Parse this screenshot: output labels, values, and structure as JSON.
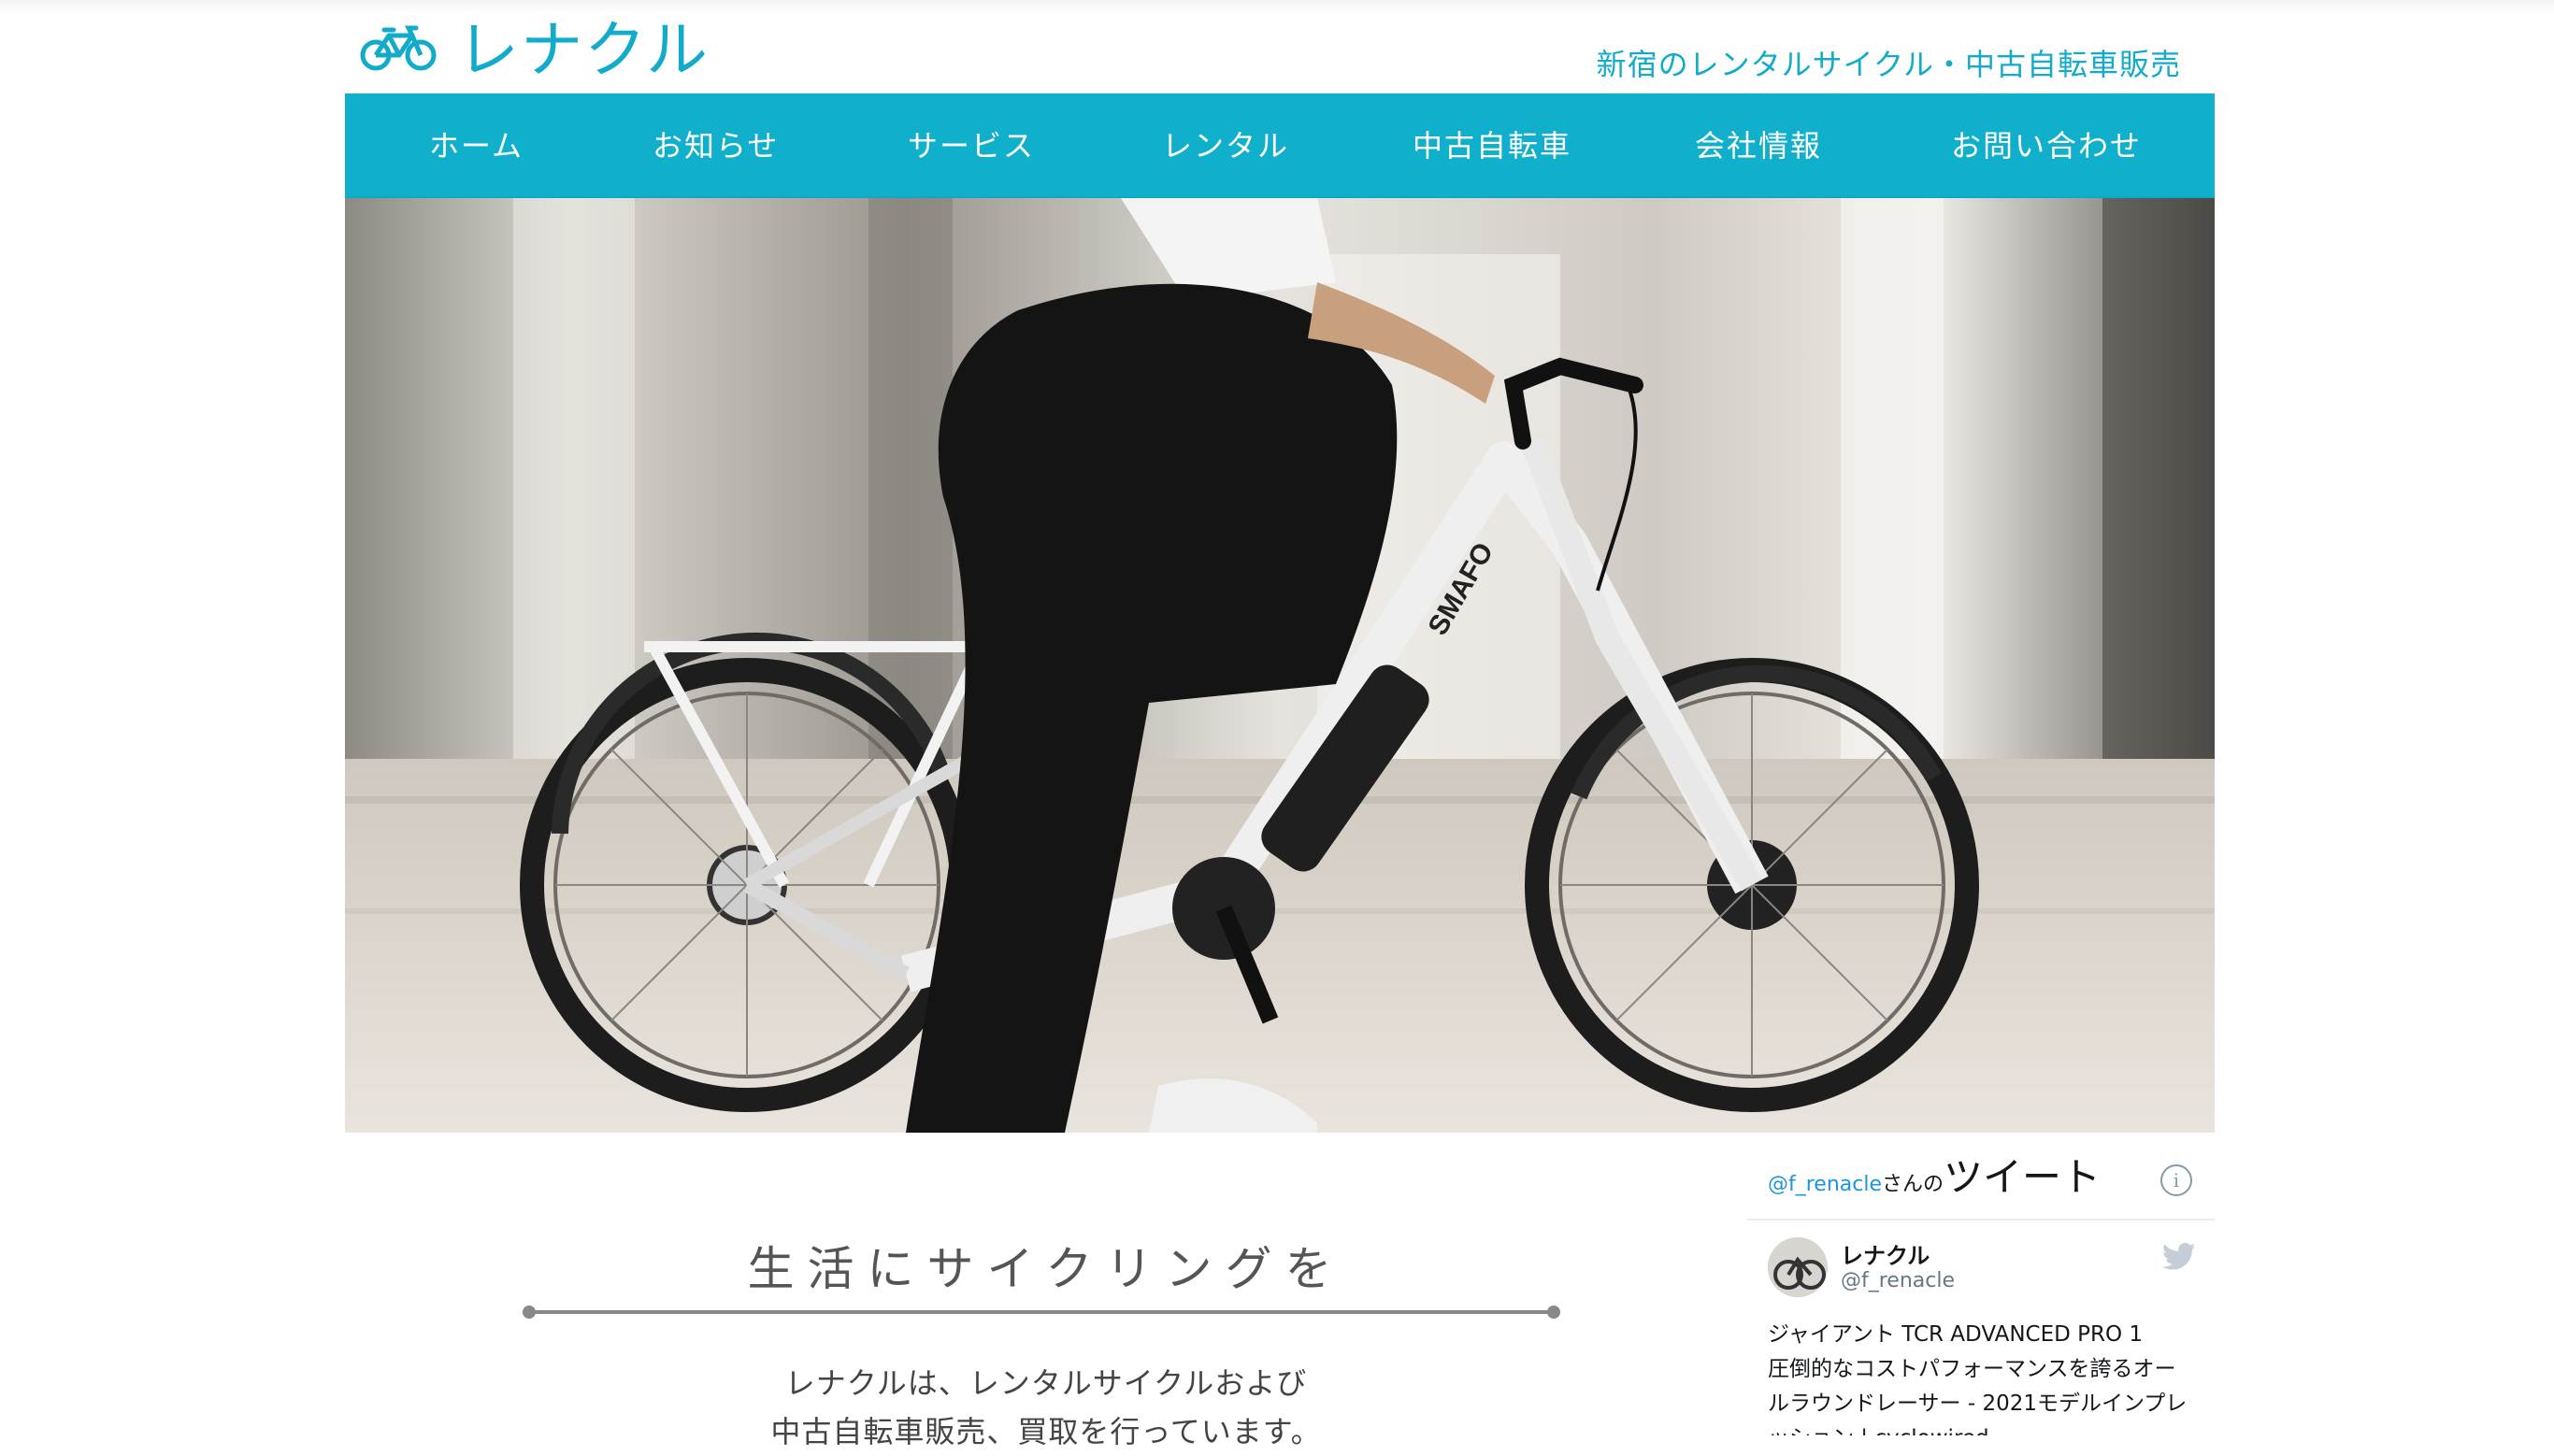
{
  "header": {
    "logo_text": "レナクル",
    "tagline": "新宿のレンタルサイクル・中古自転車販売"
  },
  "nav": {
    "items": [
      "ホーム",
      "お知らせ",
      "サービス",
      "レンタル",
      "中古自転車",
      "会社情報",
      "お問い合わせ"
    ]
  },
  "hero": {
    "frame_brand": "SMAFO"
  },
  "main": {
    "headline": "生活にサイクリングを",
    "intro_lines": [
      "レナクルは、レンタルサイクルおよび",
      "中古自転車販売、買取を行っています。"
    ]
  },
  "twitter": {
    "title_user": "@f_renacle",
    "title_san": "さんの",
    "title_label": "ツイート",
    "info_glyph": "i",
    "author_name": "レナクル",
    "author_handle": "@f_renacle",
    "tweet_lines": [
      "ジャイアント TCR ADVANCED PRO 1",
      "圧倒的なコストパフォーマンスを誇るオー",
      "ルラウンドレーサー - 2021モデルインプレ",
      "ッション | cyclowired"
    ]
  },
  "colors": {
    "brand": "#12abc9",
    "nav_bg": "#10afcc",
    "twitter_blue": "#1b95e0"
  },
  "icons": {
    "logo": "bicycle-icon",
    "twitter": "twitter-bird-icon",
    "info": "info-icon"
  }
}
